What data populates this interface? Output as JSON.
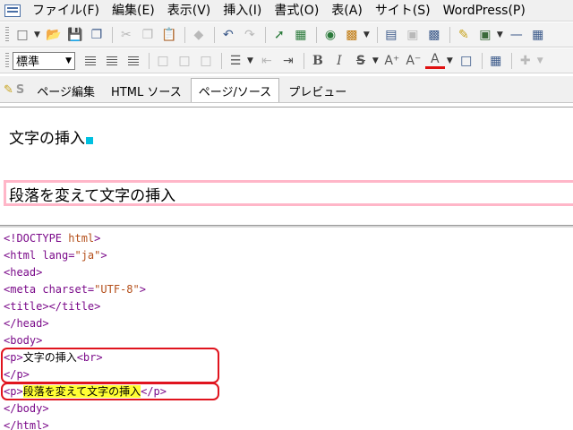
{
  "menu": {
    "items": [
      "ファイル(F)",
      "編集(E)",
      "表示(V)",
      "挿入(I)",
      "書式(O)",
      "表(A)",
      "サイト(S)",
      "WordPress(P)"
    ]
  },
  "toolbar": {
    "style_select_value": "標準"
  },
  "tabs": {
    "items": [
      "ページ編集",
      "HTML ソース",
      "ページ/ソース",
      "プレビュー"
    ],
    "active": "ページ/ソース"
  },
  "design": {
    "paragraph1": "文字の挿入",
    "paragraph2": "段落を変えて文字の挿入"
  },
  "source": {
    "line1_tag": "<!DOCTYPE ",
    "line1_attr": "html",
    "line1_end": ">",
    "line2_a": "<html lang=",
    "line2_attr": "\"ja\"",
    "line2_end": ">",
    "line3": "<head>",
    "line4_a": "<meta charset=",
    "line4_attr": "\"UTF-8\"",
    "line4_end": ">",
    "line5": "<title></title>",
    "line6": "</head>",
    "line7": "<body>",
    "line8_open": "<p>",
    "line8_text": "文字の挿入",
    "line8_br": "<br>",
    "line9": "</p>",
    "line10_open": "<p>",
    "line10_text": "段落を変えて文字の挿入",
    "line10_close": "</p>",
    "line11": "</body>",
    "line12": "</html>"
  },
  "colors": {
    "highlight_box": "#e0141e",
    "selection": "#ffff33",
    "paragraph_border": "#ffb6c8",
    "tag": "#7b0b8a",
    "attr": "#b44f1a"
  }
}
